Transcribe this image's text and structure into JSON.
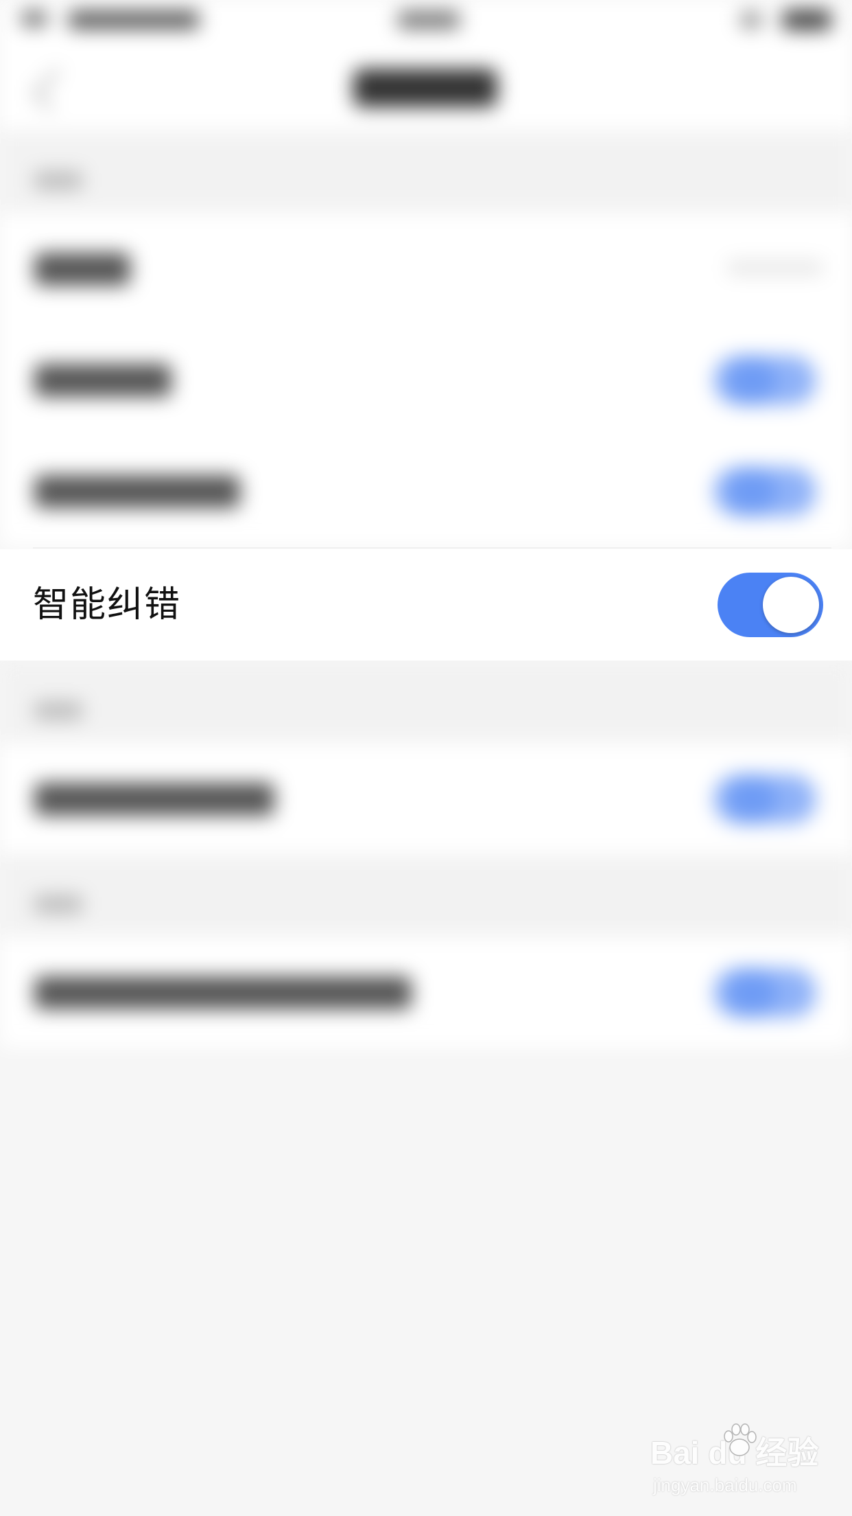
{
  "settings": {
    "smart_correction": {
      "label": "智能纠错",
      "enabled": true
    }
  },
  "colors": {
    "toggle_on": "#4b82f4",
    "background": "#f6f6f6"
  },
  "watermark": {
    "brand": "Bai du 经验",
    "url": "jingyan.baidu.com"
  }
}
